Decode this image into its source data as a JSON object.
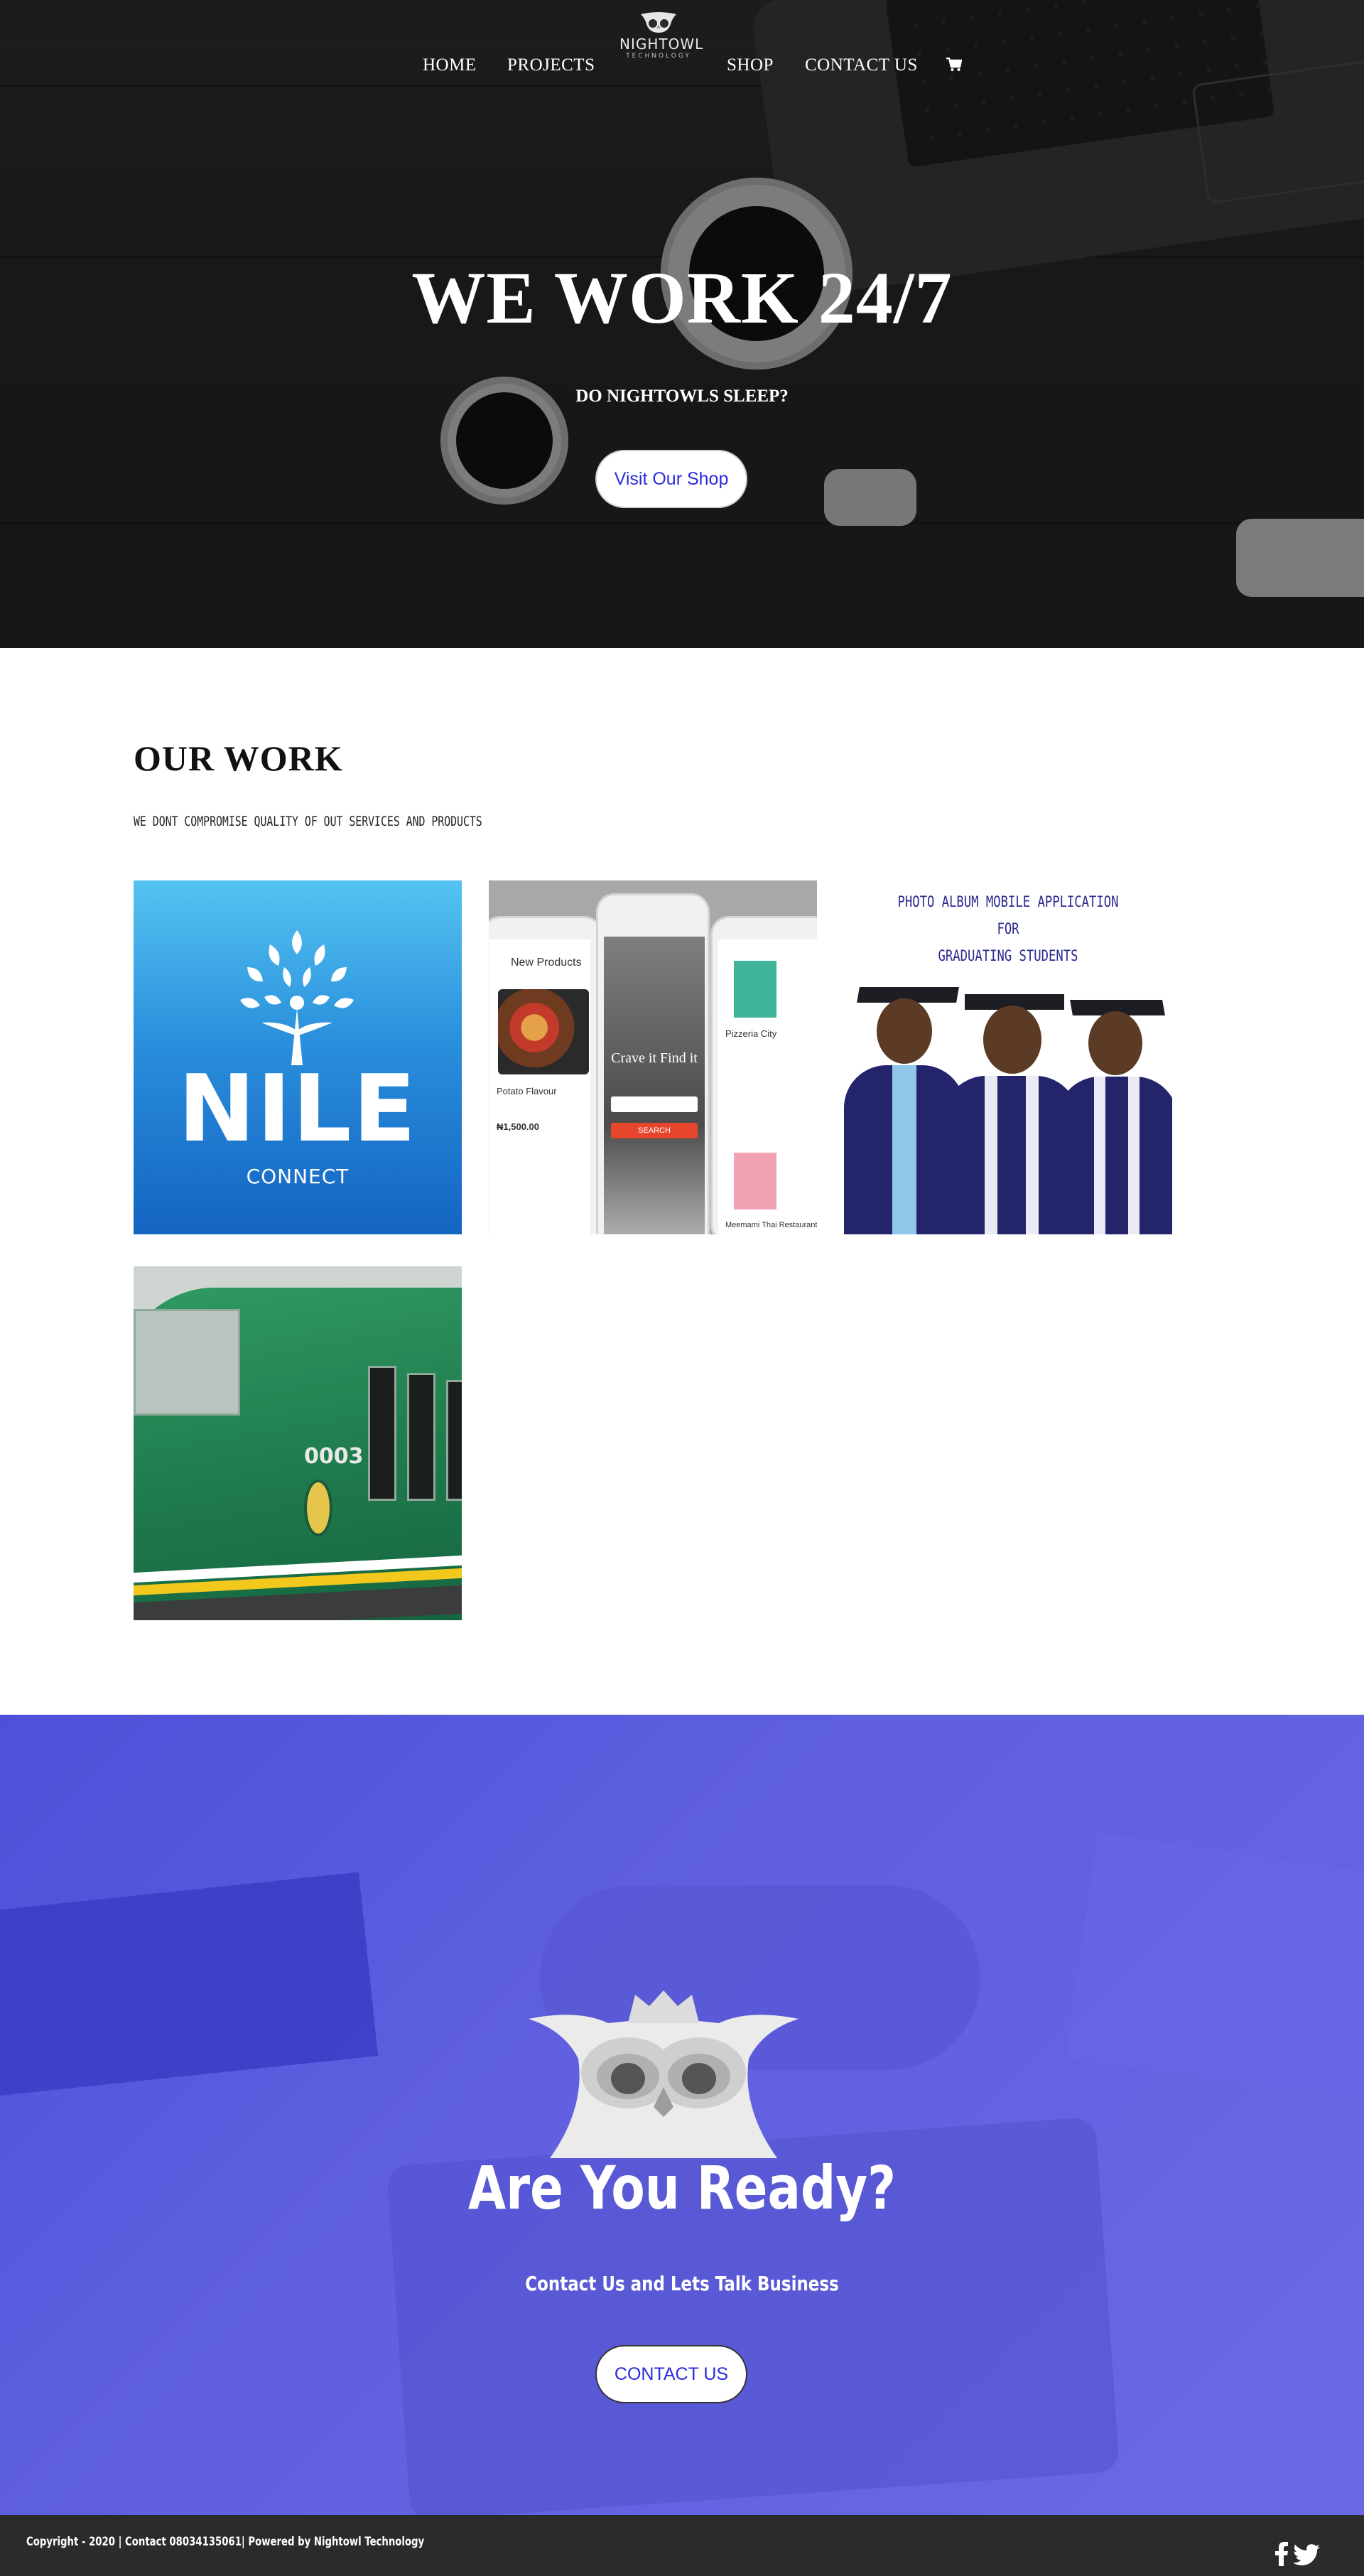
{
  "brand": {
    "name": "NIGHTOWL",
    "sub": "TECHNOLOGY"
  },
  "nav": {
    "items": [
      {
        "label": "HOME"
      },
      {
        "label": "PROJECTS"
      },
      {
        "label": "SHOP"
      },
      {
        "label": "CONTACT US"
      }
    ],
    "cart_icon": "shopping-cart-icon"
  },
  "hero": {
    "title": "WE WORK 24/7",
    "subtitle": "DO NIGHTOWLS SLEEP?",
    "button_label": "Visit Our Shop"
  },
  "work": {
    "title": "OUR WORK",
    "subtitle": "WE DONT COMPROMISE QUALITY OF OUT SERVICES AND PRODUCTS",
    "tiles": [
      {
        "word": "NILE",
        "caption": "CONNECT"
      },
      {
        "screens": {
          "left_title": "New Products",
          "left_item": "Potato Flavour",
          "left_price": "₦1,500.00",
          "center_title": "Crave it Find it",
          "center_button": "SEARCH",
          "right_item": "Pizzeria City",
          "right_item2": "Meemami Thai Restaurant"
        }
      },
      {
        "caption_lines": [
          "PHOTO ALBUM MOBILE  APPLICATION",
          "FOR",
          "GRADUATING STUDENTS"
        ]
      },
      {
        "number": "0003"
      }
    ]
  },
  "cta": {
    "title": "Are You Ready?",
    "subtitle": "Contact Us and Lets Talk Business",
    "button_label": "CONTACT US"
  },
  "footer": {
    "copyright": "Copyright - 2020 | Contact 08034135061| Powered by Nightowl Technology",
    "social": [
      "facebook-icon",
      "twitter-icon"
    ]
  }
}
